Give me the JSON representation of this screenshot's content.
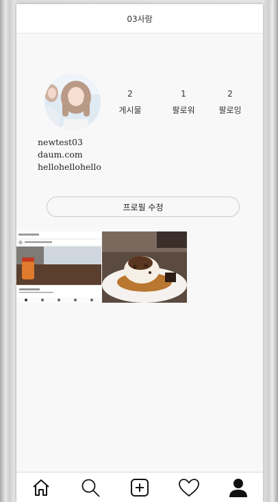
{
  "header": {
    "title": "03사람"
  },
  "profile": {
    "stats": [
      {
        "count": "2",
        "label": "게시물"
      },
      {
        "count": "1",
        "label": "팔로워"
      },
      {
        "count": "2",
        "label": "팔로잉"
      }
    ],
    "username": "newtest03",
    "website": "daum.com",
    "bio": "hellohellohello",
    "edit_button": "프로필 수정"
  },
  "posts": [
    {
      "icon": "post-screenshot-image"
    },
    {
      "icon": "post-dessert-image"
    }
  ],
  "tabbar": {
    "items": [
      {
        "icon": "home-icon"
      },
      {
        "icon": "search-icon"
      },
      {
        "icon": "add-post-icon"
      },
      {
        "icon": "heart-icon"
      },
      {
        "icon": "profile-icon"
      }
    ]
  }
}
